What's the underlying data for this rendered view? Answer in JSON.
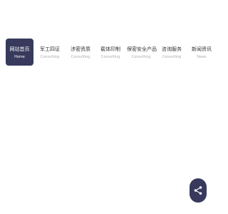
{
  "nav": {
    "items": [
      {
        "label": "网站首页",
        "sublabel": "Home",
        "active": true
      },
      {
        "label": "军工四证",
        "sublabel": "Consulting",
        "active": false
      },
      {
        "label": "涉密资质",
        "sublabel": "Consulting",
        "active": false
      },
      {
        "label": "载体印制",
        "sublabel": "Consulting",
        "active": false
      },
      {
        "label": "保密安全产品",
        "sublabel": "Consulting",
        "active": false
      },
      {
        "label": "咨询服务",
        "sublabel": "Consulting",
        "active": false
      },
      {
        "label": "新闻资讯",
        "sublabel": "News",
        "active": false
      }
    ]
  },
  "share": {
    "icon": "share-icon"
  },
  "colors": {
    "accent": "#373a5c",
    "text": "#333333",
    "subtext": "#aaaaaa"
  }
}
